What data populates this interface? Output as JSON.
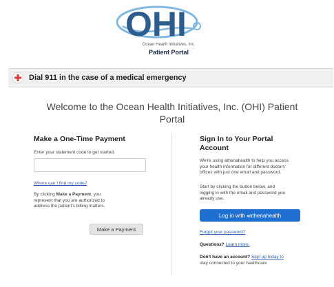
{
  "header": {
    "brand": "OHI",
    "company": "Ocean Health Initiatives, Inc.",
    "portal_label": "Patient Portal",
    "brand_color": "#2b5d8f",
    "accent_color": "#7fb8e0"
  },
  "alert": {
    "icon": "red-cross-icon",
    "text": "Dial 911 in the case of a medical emergency"
  },
  "welcome": {
    "line1": "Welcome to the Ocean Health Initiatives, Inc. (OHI) Patient",
    "line2": "Portal"
  },
  "payment": {
    "heading": "Make a One-Time Payment",
    "instruction": "Enter your statement code to get started.",
    "code_value": "",
    "code_placeholder": "",
    "find_code_link": "Where can I find my code?",
    "disclaimer_prefix": "By clicking ",
    "disclaimer_bold": "Make a Payment",
    "disclaimer_suffix": ", you",
    "disclaimer_line2": "represent that you are authorized to",
    "disclaimer_line3": "address the patient's billing matters.",
    "button_label": "Make a Payment"
  },
  "signin": {
    "heading_line1": "Sign In to Your Portal",
    "heading_line2": "Account",
    "info_lines": [
      "We're using athenahealth to help you access",
      "your health information for different doctors'",
      "offices with just one email and password."
    ],
    "start_lines": [
      "Start by clicking the button below, and",
      "logging in with the email and password you",
      "already use."
    ],
    "button_prefix": "Log in with ",
    "button_brand": "athenahealth",
    "forgot_link": "Forgot your password?",
    "questions_label": "Questions?",
    "learn_more_link": "Learn more.",
    "no_account_label": "Don't have an account?",
    "signup_link": "Sign up today to",
    "signup_line2": "stay connected to your healthcare"
  }
}
